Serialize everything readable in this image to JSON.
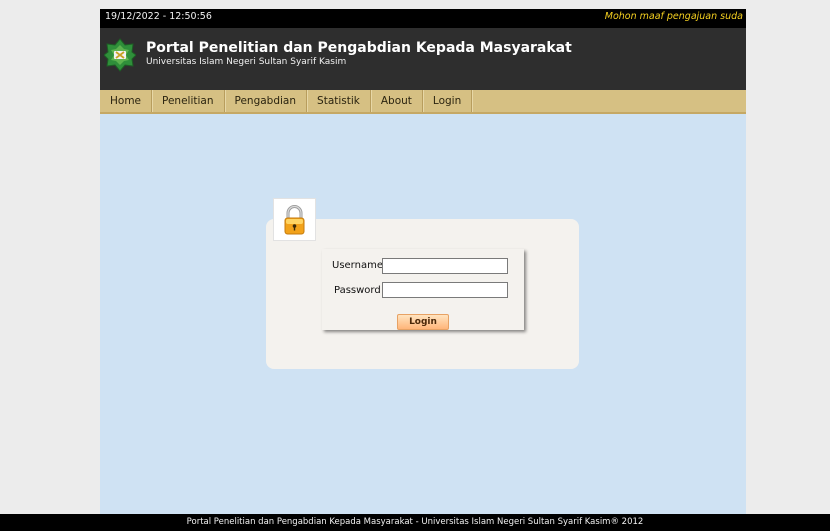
{
  "topbar": {
    "datetime": "19/12/2022 - 12:50:56",
    "marquee": "Mohon maaf pengajuan suda"
  },
  "header": {
    "title": "Portal Penelitian dan Pengabdian Kepada Masyarakat",
    "subtitle": "Universitas Islam Negeri Sultan Syarif Kasim"
  },
  "nav": {
    "items": [
      {
        "label": "Home"
      },
      {
        "label": "Penelitian"
      },
      {
        "label": "Pengabdian"
      },
      {
        "label": "Statistik"
      },
      {
        "label": "About"
      },
      {
        "label": "Login"
      }
    ]
  },
  "login": {
    "username_label": "Username:",
    "password_label": "Password :",
    "username_value": "",
    "password_value": "",
    "button_label": "Login",
    "icon": "lock-icon"
  },
  "footer": {
    "text": "Portal Penelitian dan Pengabdian Kepada Masyarakat - Universitas Islam Negeri Sultan Syarif Kasim® 2012"
  },
  "colors": {
    "background": "#ececec",
    "content_bg": "#cfe2f3",
    "header_bg": "#2e2e2e",
    "nav_bg": "#d6c083",
    "marquee": "#f5d020",
    "button_gradient_top": "#ffe4c0",
    "button_gradient_bottom": "#ffb57a"
  }
}
